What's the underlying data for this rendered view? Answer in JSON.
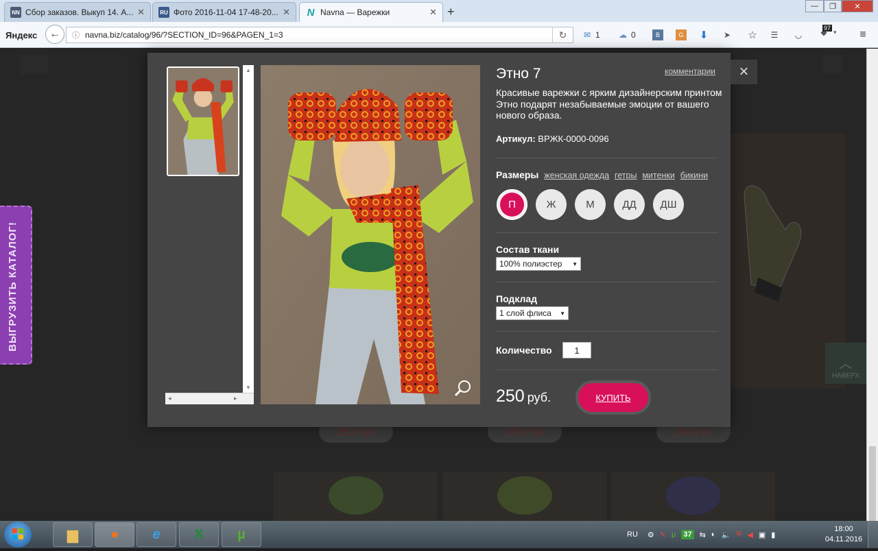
{
  "browser": {
    "tabs": [
      {
        "favicon": "NN",
        "title": "Сбор заказов. Выкуп 14. А...",
        "active": false
      },
      {
        "favicon": "RU",
        "title": "Фото 2016-11-04 17-48-20....",
        "active": false
      },
      {
        "favicon": "N",
        "title": "Navna — Варежки",
        "active": true
      }
    ],
    "new_tab": "+",
    "yandex_logo": "Яндекс",
    "url": "navna.biz/catalog/96/?SECTION_ID=96&PAGEN_1=3",
    "mail_count": "1",
    "weather_count": "0",
    "badge_count": "97"
  },
  "page": {
    "catalog_tab_label": "ВЫГРУЗИТЬ КАТАЛОГ!",
    "up_label": "НАВЕРХ",
    "bg_prices": [
      "250 Руб",
      "250 Руб",
      "250 Руб"
    ]
  },
  "modal": {
    "title": "Этно 7",
    "comments_link": "комментарии",
    "description": "Красивые варежки с ярким дизайнерским принтом Этно подарят незабываемые эмоции от вашего нового образа.",
    "article_label": "Артикул:",
    "article_value": "ВРЖК-0000-0096",
    "sizes_label": "Размеры",
    "size_links": [
      "женская одежда",
      "гетры",
      "митенки",
      "бикини"
    ],
    "sizes": [
      {
        "label": "П",
        "selected": true
      },
      {
        "label": "Ж",
        "selected": false
      },
      {
        "label": "М",
        "selected": false
      },
      {
        "label": "ДД",
        "selected": false
      },
      {
        "label": "ДШ",
        "selected": false
      }
    ],
    "fabric_label": "Состав ткани",
    "fabric_value": "100% полиэстер",
    "lining_label": "Подклад",
    "lining_value": "1 слой флиса",
    "quantity_label": "Количество",
    "quantity_value": "1",
    "price_value": "250",
    "price_currency": "руб.",
    "buy_label": "КУПИТЬ",
    "close_icon": "×"
  },
  "taskbar": {
    "language": "RU",
    "tray_count": "37",
    "time": "18:00",
    "date": "04.11.2016"
  },
  "colors": {
    "accent": "#d8105a",
    "modal_bg": "#454545",
    "catalog_tab": "#8b3fb0"
  }
}
